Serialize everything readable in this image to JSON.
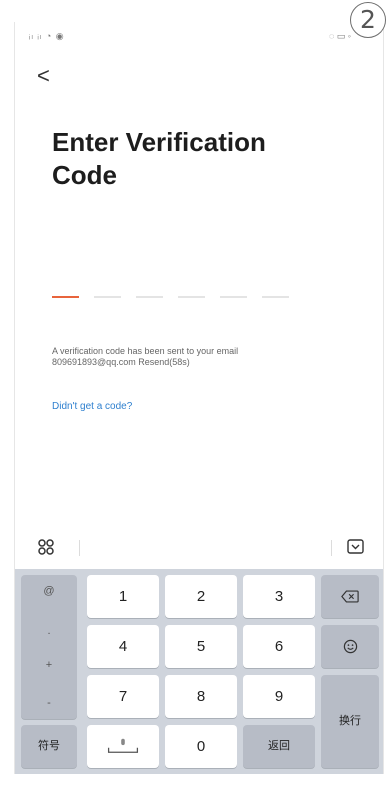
{
  "step": {
    "number": "2"
  },
  "status_bar": {
    "left": "",
    "right": ""
  },
  "header": {
    "back_glyph": "<"
  },
  "title": {
    "line1": "Enter Verification",
    "line2": "Code"
  },
  "code_input": {
    "slots": 6,
    "active_index": 0,
    "accent_color": "#e8643c"
  },
  "info": {
    "line1": "A verification code has been sent to your email",
    "email": "809691893@qq.com",
    "resend": "Resend(58s)"
  },
  "help_link": "Didn't get a code?",
  "keyboard": {
    "left_col": [
      "@",
      ".",
      "+",
      "-"
    ],
    "digits": [
      "1",
      "2",
      "3",
      "4",
      "5",
      "6",
      "7",
      "8",
      "9",
      "0"
    ],
    "symbols_label": "符号",
    "back_label": "返回",
    "enter_label": "换行"
  },
  "colors": {
    "link": "#2f80cf",
    "keyboard_bg": "#cfd4dc"
  }
}
